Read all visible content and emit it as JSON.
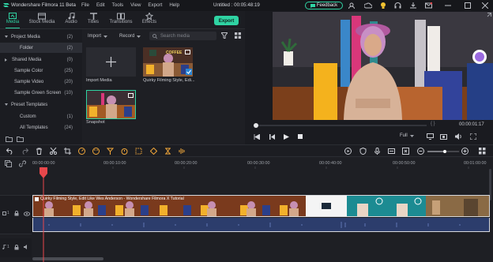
{
  "app": {
    "title": "Wondershare Filmora 11 Beta",
    "project": "Untitled : 00:05:48:19"
  },
  "menu": [
    "File",
    "Edit",
    "Tools",
    "View",
    "Export",
    "Help"
  ],
  "feedback_label": "Feedback",
  "tabs": [
    {
      "label": "Media",
      "icon": "media-icon"
    },
    {
      "label": "Stock Media",
      "icon": "stock-media-icon"
    },
    {
      "label": "Audio",
      "icon": "music-icon"
    },
    {
      "label": "Titles",
      "icon": "titles-icon"
    },
    {
      "label": "Transitions",
      "icon": "transitions-icon"
    },
    {
      "label": "Effects",
      "icon": "effects-icon"
    }
  ],
  "export_label": "Export",
  "library": [
    {
      "label": "Project Media",
      "count": "(2)",
      "indent": 0,
      "caret": true
    },
    {
      "label": "Folder",
      "count": "(2)",
      "indent": 1,
      "selected": true
    },
    {
      "label": "Shared Media",
      "count": "(0)",
      "indent": 0,
      "caret": true
    },
    {
      "label": "Sample Color",
      "count": "(25)",
      "indent": 1
    },
    {
      "label": "Sample Video",
      "count": "(20)",
      "indent": 1
    },
    {
      "label": "Sample Green Screen",
      "count": "(10)",
      "indent": 1
    },
    {
      "label": "Preset Templates",
      "count": "",
      "indent": 0,
      "caret": true
    },
    {
      "label": "Custom",
      "count": "(1)",
      "indent": 1
    },
    {
      "label": "All Templates",
      "count": "(24)",
      "indent": 1
    }
  ],
  "media_toolbar": {
    "import": "Import",
    "record": "Record",
    "search_placeholder": "Search media"
  },
  "media_items": [
    {
      "caption": "Import Media"
    },
    {
      "caption": "Quirky Filming Style, Edi..."
    },
    {
      "caption": "Snapshot"
    }
  ],
  "thumb_text": "COFFEE",
  "player": {
    "time": "00:00:01:17",
    "quality": "Full",
    "brackets": "{    }"
  },
  "ruler": [
    "00:00:00:00",
    "00:00:10:00",
    "00:00:20:00",
    "00:00:30:00",
    "00:00:40:00",
    "00:00:50:00",
    "00:01:00:00"
  ],
  "clip_title": "Quirky Filming Style, Edit Like Wes Anderson - Wondershare Filmora X Tutorial",
  "track_labels": {
    "video": "1",
    "audio": "1"
  },
  "colors": {
    "accent": "#2fd3a3",
    "playhead": "#e8474b",
    "audio": "#2c3d6c"
  }
}
